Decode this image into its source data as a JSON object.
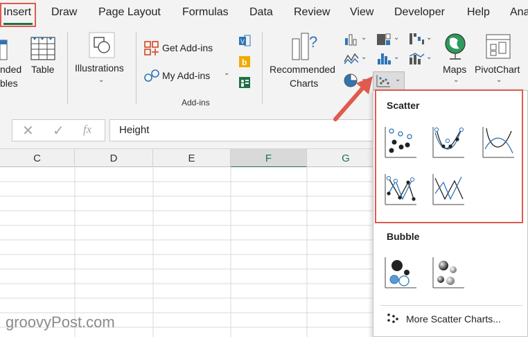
{
  "tabs": [
    "Insert",
    "Draw",
    "Page Layout",
    "Formulas",
    "Data",
    "Review",
    "View",
    "Developer",
    "Help",
    "Ana"
  ],
  "ribbon": {
    "recommended_pivot_line1": "nded",
    "recommended_pivot_line2": "bles",
    "table_label": "Table",
    "illustrations_label": "Illustrations",
    "get_addins_label": "Get Add-ins",
    "my_addins_label": "My Add-ins",
    "addins_group_label": "Add-ins",
    "recommended_charts_line1": "Recommended",
    "recommended_charts_line2": "Charts",
    "maps_label": "Maps",
    "pivotchart_label": "PivotChart"
  },
  "formula_bar": {
    "value": "Height",
    "cancel_icon": "x-icon",
    "enter_icon": "check-icon",
    "function_icon": "fx-icon"
  },
  "columns": [
    "C",
    "D",
    "E",
    "F",
    "G"
  ],
  "dropdown": {
    "scatter_heading": "Scatter",
    "bubble_heading": "Bubble",
    "more_link": "More Scatter Charts..."
  },
  "watermark": "groovyPost.com",
  "colors": {
    "highlight": "#e05a4e",
    "excel_green": "#1e7145",
    "chart_blue": "#2e75b6",
    "selected_col": "#1e7145"
  }
}
